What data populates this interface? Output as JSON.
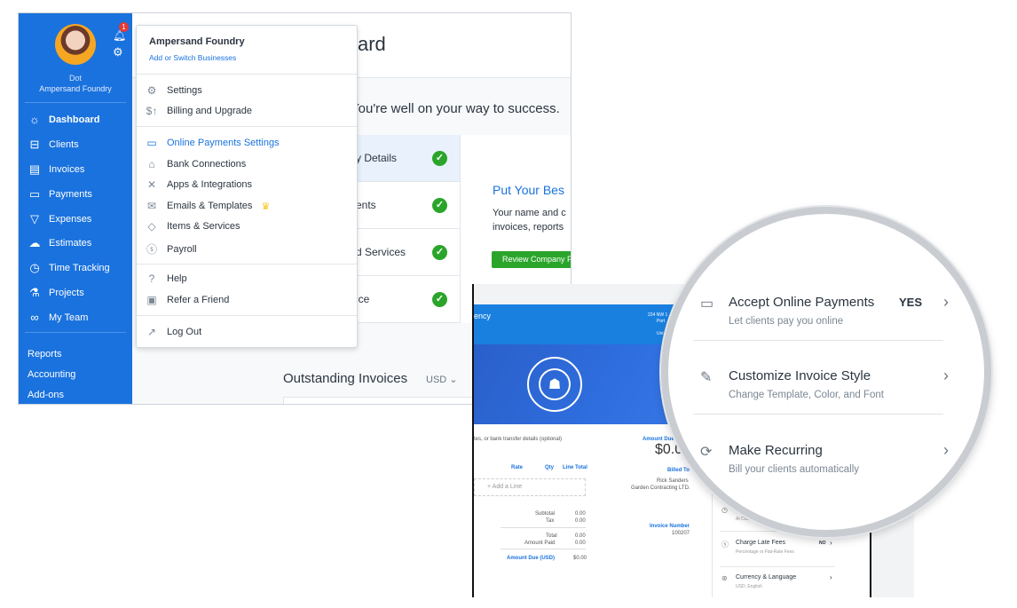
{
  "sidebar": {
    "user_name": "Dot",
    "business": "Ampersand Foundry",
    "notification_count": "1",
    "items": [
      {
        "label": "Dashboard",
        "icon": "sun-icon"
      },
      {
        "label": "Clients",
        "icon": "clients-icon"
      },
      {
        "label": "Invoices",
        "icon": "invoice-icon"
      },
      {
        "label": "Payments",
        "icon": "wallet-icon"
      },
      {
        "label": "Expenses",
        "icon": "expenses-icon"
      },
      {
        "label": "Estimates",
        "icon": "estimates-icon"
      },
      {
        "label": "Time Tracking",
        "icon": "stopwatch-icon"
      },
      {
        "label": "Projects",
        "icon": "flask-icon"
      },
      {
        "label": "My Team",
        "icon": "team-icon"
      }
    ],
    "secondary": [
      "Reports",
      "Accounting",
      "Add-ons"
    ],
    "color": "#1a72de"
  },
  "menu": {
    "business": "Ampersand Foundry",
    "switch_link": "Add or Switch Businesses",
    "items": [
      {
        "label": "Settings",
        "icon": "gear-icon"
      },
      {
        "label": "Billing and Upgrade",
        "icon": "dollar-up-icon"
      },
      {
        "label": "Online Payments Settings",
        "icon": "card-icon"
      },
      {
        "label": "Bank Connections",
        "icon": "bank-icon"
      },
      {
        "label": "Apps & Integrations",
        "icon": "tools-icon"
      },
      {
        "label": "Emails & Templates",
        "icon": "envelope-icon"
      },
      {
        "label": "Items & Services",
        "icon": "tag-icon"
      },
      {
        "label": "Payroll",
        "icon": "dollar-circle-icon"
      },
      {
        "label": "Help",
        "icon": "help-icon"
      },
      {
        "label": "Refer a Friend",
        "icon": "gift-icon"
      },
      {
        "label": "Log Out",
        "icon": "logout-icon"
      }
    ]
  },
  "main": {
    "title": "ard",
    "subtitle": "You're well on your way to success.",
    "steps": [
      "y Details",
      "ents",
      "d Services",
      "ice"
    ],
    "panel_title": "Put Your Bes",
    "panel_text_1": "Your name and c",
    "panel_text_2": "invoices, reports",
    "panel_button": "Review Company P",
    "outstanding": "Outstanding Invoices",
    "currency": "USD"
  },
  "invoice": {
    "company": "ency",
    "address_1": "224 NW 1",
    "address_2": "Port",
    "address_3": "Uni",
    "notes_placeholder": "tes, or bank transfer details (optional)",
    "amount_due_label": "Amount Due",
    "amount_due": "$0.0",
    "cols": [
      "Rate",
      "Qty",
      "Line Total"
    ],
    "add_line": "Add a Line",
    "billed_to_label": "Billed To",
    "billed_to_name": "Rick Sanders",
    "billed_to_company": "Garden Contracting LTD.",
    "invoice_number_label": "Invoice Number",
    "invoice_number": "100207",
    "totals": [
      {
        "label": "Subtotal",
        "value": "0.00"
      },
      {
        "label": "Tax",
        "value": "0.00"
      },
      {
        "label": "Total",
        "value": "0.00"
      },
      {
        "label": "Amount Paid",
        "value": "0.00"
      }
    ],
    "amount_due_usd_label": "Amount Due (USD)",
    "amount_due_usd": "$0.00",
    "settings": [
      {
        "title": "",
        "desc": "At Cus"
      },
      {
        "title": "Charge Late Fees",
        "desc": "Percentage or Flat-Rate Fees",
        "value": "NO"
      },
      {
        "title": "Currency & Language",
        "desc": "USD, English"
      }
    ]
  },
  "lens": {
    "items": [
      {
        "title": "Accept Online Payments",
        "desc": "Let clients pay you online",
        "value": "YES",
        "icon": "card-icon"
      },
      {
        "title": "Customize Invoice Style",
        "desc": "Change Template, Color, and Font",
        "icon": "paintbrush-icon"
      },
      {
        "title": "Make Recurring",
        "desc": "Bill your clients automatically",
        "icon": "recurring-icon"
      }
    ]
  }
}
